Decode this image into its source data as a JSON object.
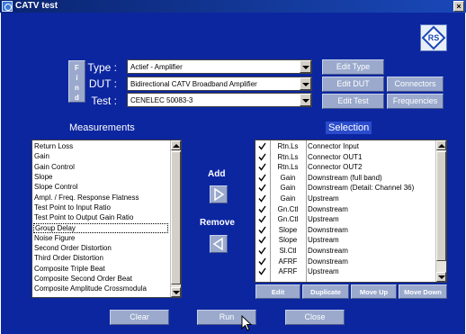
{
  "window": {
    "title": "CATV test",
    "close_glyph": "×"
  },
  "logo": {
    "icon": "rohde-schwarz-logo-icon"
  },
  "find": {
    "label": "Find",
    "letters": [
      "F",
      "i",
      "n",
      "d"
    ]
  },
  "fields": {
    "type": {
      "label": "Type :",
      "value": "Actief - Amplifier"
    },
    "dut": {
      "label": "DUT :",
      "value": "Bidirectional CATV Broadband Amplifier"
    },
    "test": {
      "label": "Test :",
      "value": "CENELEC 50083-3"
    }
  },
  "side_buttons": {
    "edit_type": "Edit Type",
    "edit_dut": "Edit DUT",
    "edit_test": "Edit Test",
    "connectors": "Connectors",
    "frequencies": "Frequencies"
  },
  "measurements": {
    "title": "Measurements",
    "items": [
      "Return Loss",
      "Gain",
      "Gain Control",
      "Slope",
      "Slope Control",
      "Ampl. / Freq. Response Flatness",
      "Test Point to Input Ratio",
      "Test Point to Output Gain Ratio",
      "Group Delay",
      "Noise Figure",
      "Second Order Distortion",
      "Third Order Distortion",
      "Composite Triple Beat",
      "Composite Second Order Beat",
      "Composite Amplitude Crossmodula"
    ],
    "selected_index": 8
  },
  "transfer": {
    "add_label": "Add",
    "remove_label": "Remove"
  },
  "selection": {
    "title": "Selection",
    "rows": [
      {
        "checked": true,
        "code": "Rtn.Ls",
        "desc": "Connector Input"
      },
      {
        "checked": true,
        "code": "Rtn.Ls",
        "desc": "Connector OUT1"
      },
      {
        "checked": true,
        "code": "Rtn.Ls",
        "desc": "Connector OUT2"
      },
      {
        "checked": true,
        "code": "Gain",
        "desc": "Downstream (full band)"
      },
      {
        "checked": true,
        "code": "Gain",
        "desc": "Downstream (Detail: Channel 36)"
      },
      {
        "checked": true,
        "code": "Gain",
        "desc": "Upstream"
      },
      {
        "checked": true,
        "code": "Gn.Ctl",
        "desc": "Downstream"
      },
      {
        "checked": true,
        "code": "Gn.Ctl",
        "desc": "Upstream"
      },
      {
        "checked": true,
        "code": "Slope",
        "desc": "Downstream"
      },
      {
        "checked": true,
        "code": "Slope",
        "desc": "Upstream"
      },
      {
        "checked": true,
        "code": "Sl.Ctl",
        "desc": "Downstream"
      },
      {
        "checked": true,
        "code": "AFRF",
        "desc": "Downstream"
      },
      {
        "checked": true,
        "code": "AFRF",
        "desc": "Upstream"
      }
    ],
    "buttons": {
      "edit": "Edit",
      "duplicate": "Duplicate",
      "move_up": "Move Up",
      "move_down": "Move Down"
    }
  },
  "footer": {
    "clear": "Clear",
    "run": "Run",
    "close": "Close"
  },
  "colors": {
    "panel": "#0c26a0",
    "button": "#9aa9cc",
    "titlebar": "#0a2470"
  }
}
